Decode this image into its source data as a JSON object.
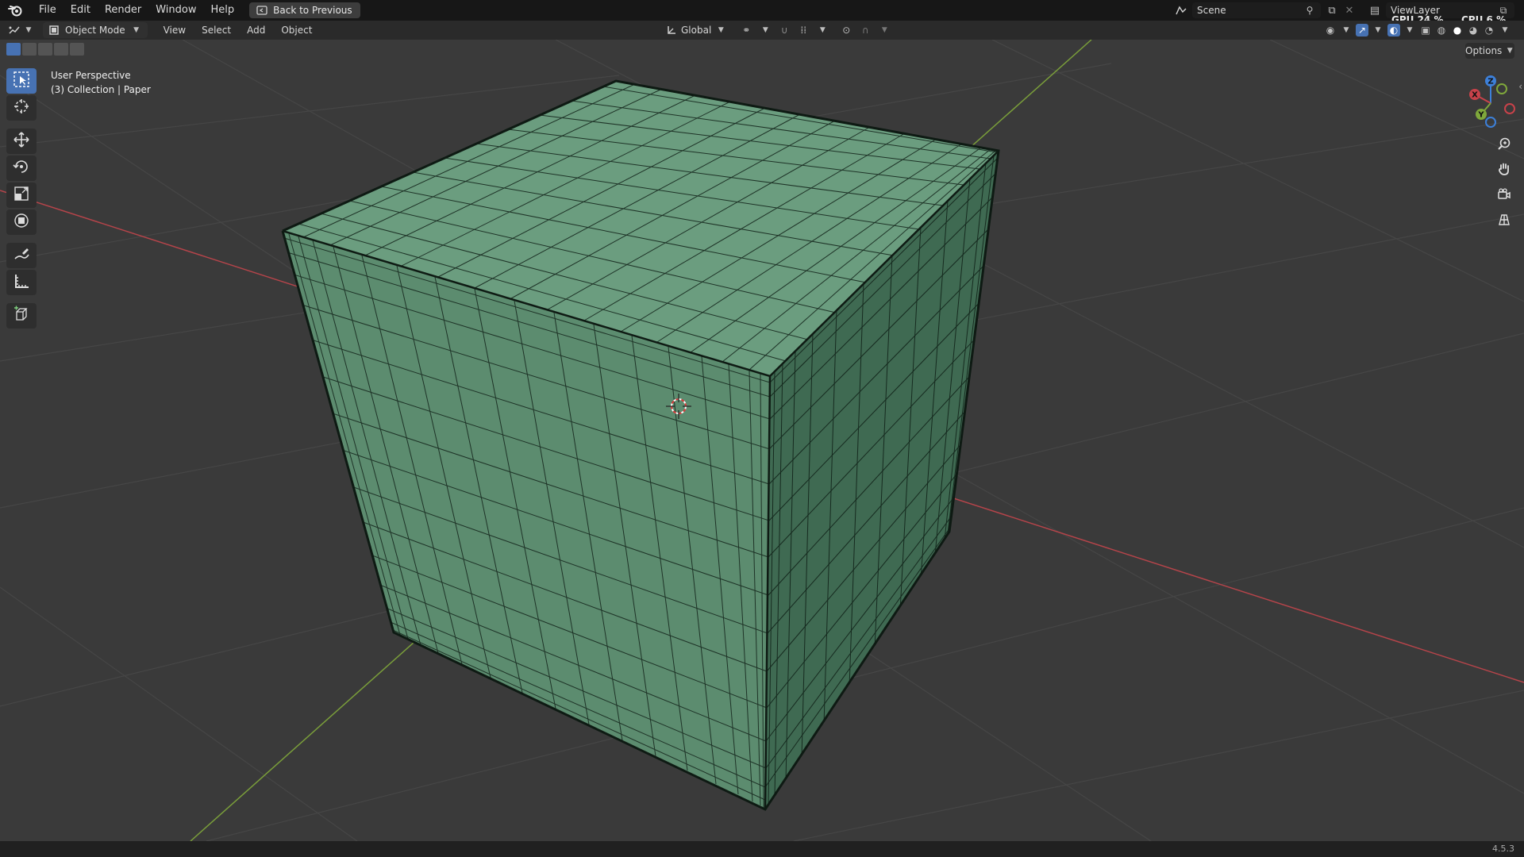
{
  "topbar": {
    "menus": [
      "File",
      "Edit",
      "Render",
      "Window",
      "Help"
    ],
    "back_button": "Back to Previous",
    "scene_label": "Scene",
    "viewlayer_label": "ViewLayer",
    "gpu_label": "GPU",
    "gpu_value": "24 %",
    "cpu_label": "CPU",
    "cpu_value": "6 %"
  },
  "header": {
    "mode": "Object Mode",
    "menus": [
      "View",
      "Select",
      "Add",
      "Object"
    ],
    "transform_orientation": "Global",
    "options_label": "Options"
  },
  "viewport": {
    "view_name": "User Perspective",
    "collection_info": "(3) Collection | Paper"
  },
  "gizmo": {
    "x_label": "X",
    "y_label": "Y",
    "z_label": "Z"
  },
  "statusbar": {
    "version": "4.5.3"
  },
  "colors": {
    "accent": "#4772b3",
    "mesh_fill": "#5f8e72",
    "x_axis": "#c8424a",
    "y_axis": "#7fa83b",
    "z_axis": "#3d80d9"
  }
}
